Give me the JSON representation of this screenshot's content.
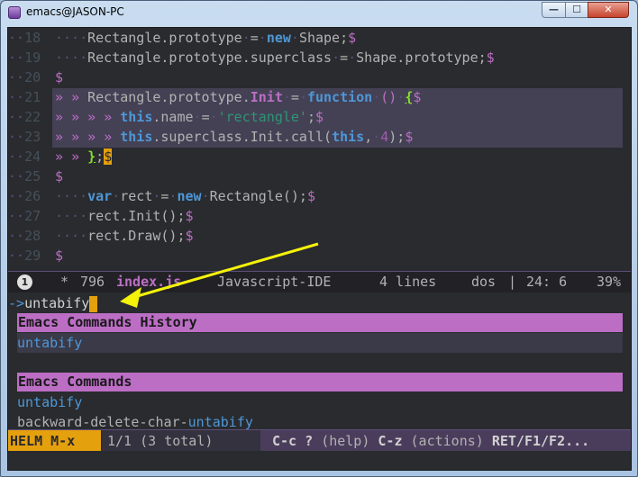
{
  "window": {
    "title": "emacs@JASON-PC",
    "buttons": {
      "minimize": "—",
      "maximize": "☐",
      "close": "✕"
    },
    "colors": {
      "bg": "#292b2e",
      "keyword": "#4f97d7",
      "function": "#bc6ec5",
      "string": "#2d9574",
      "helm_header": "#bc6ec5",
      "helm_name": "#e5a00d",
      "arrow": "#f5f20a"
    }
  },
  "editor": {
    "whitespace_dot": "·",
    "lines": {
      "l18": {
        "num": "18"
      },
      "l19": {
        "num": "19"
      },
      "l20": {
        "num": "20"
      },
      "l21": {
        "num": "21"
      },
      "l22": {
        "num": "22"
      },
      "l23": {
        "num": "23"
      },
      "l24": {
        "num": "24"
      },
      "l25": {
        "num": "25"
      },
      "l26": {
        "num": "26"
      },
      "l27": {
        "num": "27"
      },
      "l28": {
        "num": "28"
      },
      "l29": {
        "num": "29"
      }
    },
    "tokens": {
      "rect_proto_eq": "Rectangle.prototype",
      "eq": "=",
      "kw_new": "new",
      "shape_call": "Shape;",
      "dollar": "$",
      "superclass": "Rectangle.prototype.superclass",
      "shape_proto": "Shape.prototype;",
      "init_prefix": "Rectangle.prototype.",
      "init_name": "Init",
      "kw_function": "function",
      "parens": "()",
      "open_brace": "{",
      "kw_this": "this",
      "name_prop": ".name",
      "rectangle_str": "'rectangle'",
      "semi": ";",
      "super_init": ".superclass.Init.call(",
      "this2": "this",
      "comma": ",",
      "four": "4",
      "close_call": ");",
      "close_brace": "}",
      "close_brace_semi": ";",
      "kw_var": "var",
      "rect_var": "rect",
      "rect_ctor": "Rectangle();",
      "rect_init": "rect.Init();",
      "rect_draw": "rect.Draw();",
      "tab_marker": "»"
    }
  },
  "modeline": {
    "window_number": "1",
    "modified": "*",
    "size": "796",
    "buffer": "index.js",
    "mode": "Javascript-IDE",
    "lines": "4 lines",
    "eol": "dos",
    "sep": "|",
    "position": "24: 6",
    "percent": "39%"
  },
  "minibuffer": {
    "prompt": "->",
    "input": "untabify"
  },
  "helm": {
    "section1": "Emacs Commands History",
    "s1_items": [
      "untabify"
    ],
    "section2": "Emacs Commands",
    "s2_items": {
      "first": "untabify",
      "second_prefix": "backward-delete-char-",
      "second_match": "untabify"
    },
    "name": "HELM M-x",
    "count": "1/1 (3 total)",
    "keys": {
      "k1": "C-c ?",
      "d1": "(help)",
      "k2": "C-z",
      "d2": "(actions)",
      "k3": "RET/F1/F2..."
    }
  }
}
